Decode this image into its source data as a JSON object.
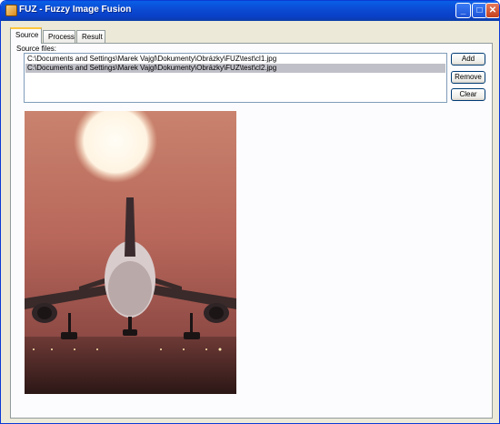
{
  "window": {
    "title": "FUZ - Fuzzy Image Fusion",
    "controls": {
      "minimize": "_",
      "maximize": "□",
      "close": "✕"
    }
  },
  "tabs": [
    {
      "label": "Source",
      "active": true
    },
    {
      "label": "Process",
      "active": false
    },
    {
      "label": "Result",
      "active": false
    }
  ],
  "source": {
    "label": "Source files:",
    "files": [
      {
        "path": "C:\\Documents and Settings\\Marek Vajgl\\Dokumenty\\Obrázky\\FUZ\\test\\cl1.jpg",
        "selected": false
      },
      {
        "path": "C:\\Documents and Settings\\Marek Vajgl\\Dokumenty\\Obrázky\\FUZ\\test\\cl2.jpg",
        "selected": true
      }
    ],
    "buttons": {
      "add": "Add",
      "remove": "Remove",
      "clear": "Clear"
    }
  },
  "colors": {
    "title_bar": "#0a5fe7",
    "tab_highlight": "#ffc73c",
    "selection": "#c0c0c8",
    "sky": "#b8675a"
  }
}
